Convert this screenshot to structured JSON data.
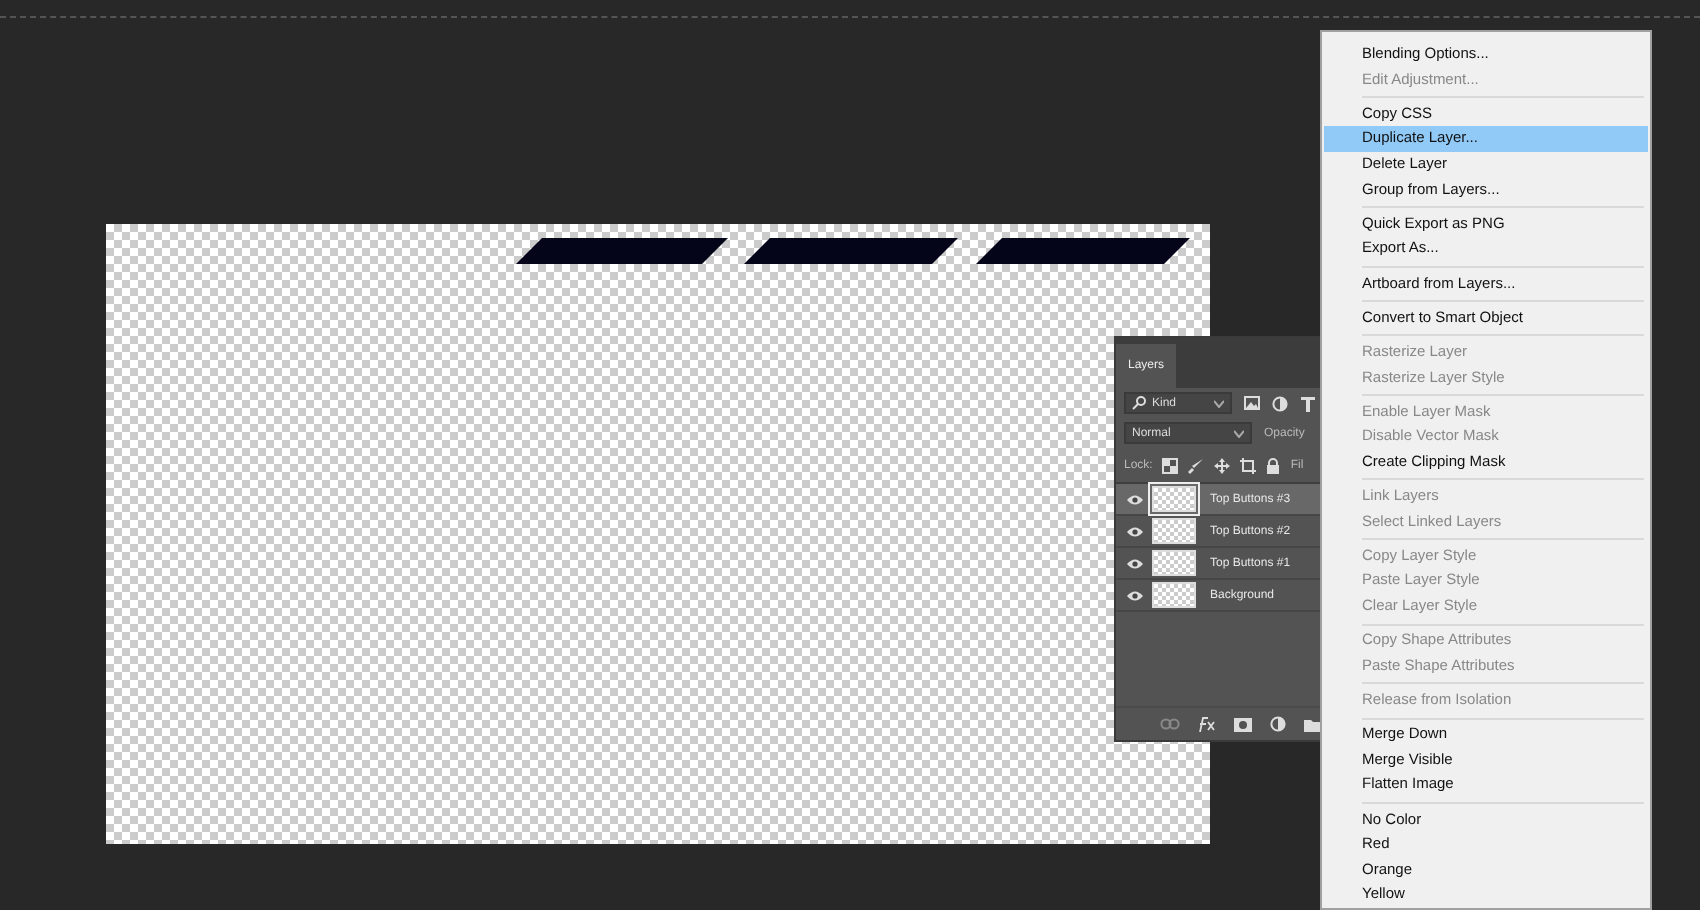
{
  "layers_panel": {
    "tab": {
      "label": "Layers",
      "selected": true
    },
    "filter": {
      "value": "Kind"
    },
    "blend_mode": {
      "value": "Normal"
    },
    "opacity_label": "Opacity",
    "lock_label": "Lock:",
    "fill_label": "Fil",
    "layers": [
      {
        "name": "Top Buttons #3",
        "visible": true,
        "selected": true
      },
      {
        "name": "Top Buttons #2",
        "visible": true,
        "selected": false
      },
      {
        "name": "Top Buttons #1",
        "visible": true,
        "selected": false
      },
      {
        "name": "Background",
        "visible": true,
        "selected": false
      }
    ]
  },
  "context_menu": {
    "groups": [
      {
        "items": [
          {
            "label": "Blending Options...",
            "disabled": false,
            "selected": false
          },
          {
            "label": "Edit Adjustment...",
            "disabled": true,
            "selected": false
          }
        ]
      },
      {
        "items": [
          {
            "label": "Copy CSS",
            "disabled": false,
            "selected": false
          },
          {
            "label": "Duplicate Layer...",
            "disabled": false,
            "selected": true
          },
          {
            "label": "Delete Layer",
            "disabled": false,
            "selected": false
          },
          {
            "label": "Group from Layers...",
            "disabled": false,
            "selected": false
          }
        ]
      },
      {
        "items": [
          {
            "label": "Quick Export as PNG",
            "disabled": false,
            "selected": false
          },
          {
            "label": "Export As...",
            "disabled": false,
            "selected": false
          }
        ]
      },
      {
        "items": [
          {
            "label": "Artboard from Layers...",
            "disabled": false,
            "selected": false
          }
        ]
      },
      {
        "items": [
          {
            "label": "Convert to Smart Object",
            "disabled": false,
            "selected": false
          }
        ]
      },
      {
        "items": [
          {
            "label": "Rasterize Layer",
            "disabled": true,
            "selected": false
          },
          {
            "label": "Rasterize Layer Style",
            "disabled": true,
            "selected": false
          }
        ]
      },
      {
        "items": [
          {
            "label": "Enable Layer Mask",
            "disabled": true,
            "selected": false
          },
          {
            "label": "Disable Vector Mask",
            "disabled": true,
            "selected": false
          },
          {
            "label": "Create Clipping Mask",
            "disabled": false,
            "selected": false
          }
        ]
      },
      {
        "items": [
          {
            "label": "Link Layers",
            "disabled": true,
            "selected": false
          },
          {
            "label": "Select Linked Layers",
            "disabled": true,
            "selected": false
          }
        ]
      },
      {
        "items": [
          {
            "label": "Copy Layer Style",
            "disabled": true,
            "selected": false
          },
          {
            "label": "Paste Layer Style",
            "disabled": true,
            "selected": false
          },
          {
            "label": "Clear Layer Style",
            "disabled": true,
            "selected": false
          }
        ]
      },
      {
        "items": [
          {
            "label": "Copy Shape Attributes",
            "disabled": true,
            "selected": false
          },
          {
            "label": "Paste Shape Attributes",
            "disabled": true,
            "selected": false
          }
        ]
      },
      {
        "items": [
          {
            "label": "Release from Isolation",
            "disabled": true,
            "selected": false
          }
        ]
      },
      {
        "items": [
          {
            "label": "Merge Down",
            "disabled": false,
            "selected": false
          },
          {
            "label": "Merge Visible",
            "disabled": false,
            "selected": false
          },
          {
            "label": "Flatten Image",
            "disabled": false,
            "selected": false
          }
        ]
      },
      {
        "items": [
          {
            "label": "No Color",
            "disabled": false,
            "selected": false
          },
          {
            "label": "Red",
            "disabled": false,
            "selected": false
          },
          {
            "label": "Orange",
            "disabled": false,
            "selected": false
          },
          {
            "label": "Yellow",
            "disabled": false,
            "selected": false
          }
        ]
      }
    ]
  }
}
